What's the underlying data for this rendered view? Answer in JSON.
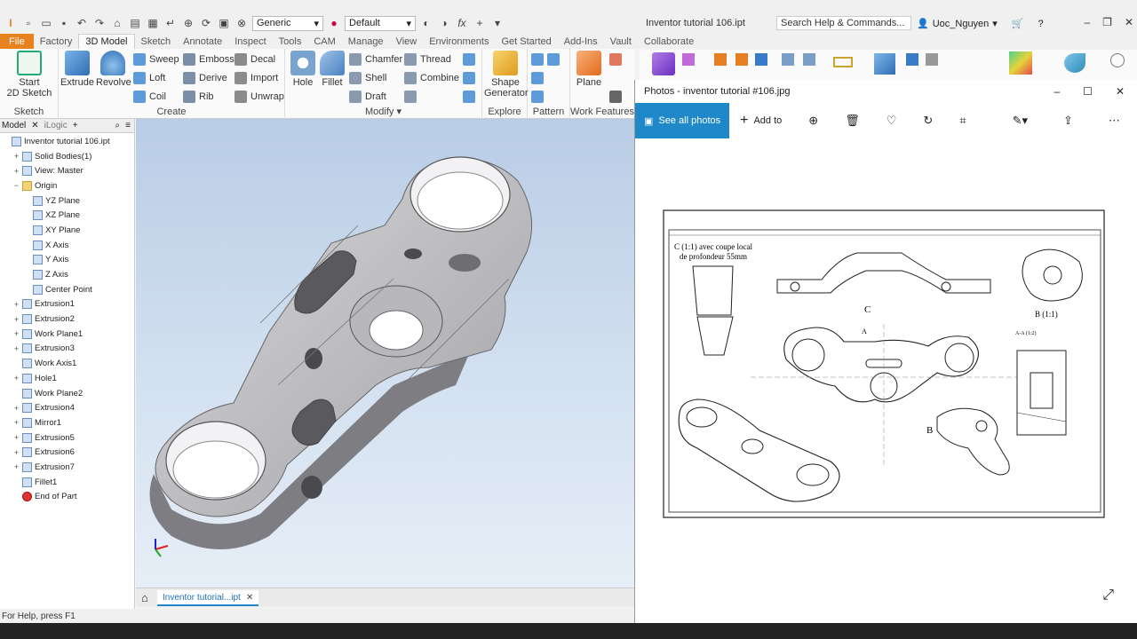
{
  "app": {
    "title": "Inventor tutorial 106.ipt",
    "search_placeholder": "Search Help & Commands...",
    "user": "Uoc_Nguyen",
    "material": "Generic",
    "appearance": "Default"
  },
  "ribbon_tabs": [
    "File",
    "Factory",
    "3D Model",
    "Sketch",
    "Annotate",
    "Inspect",
    "Tools",
    "CAM",
    "Manage",
    "View",
    "Environments",
    "Get Started",
    "Add-Ins",
    "Vault",
    "Collaborate"
  ],
  "ribbon": {
    "sketch": {
      "title": "Sketch",
      "start": "Start",
      "start2": "2D Sketch"
    },
    "create": {
      "title": "Create",
      "extrude": "Extrude",
      "revolve": "Revolve",
      "sweep": "Sweep",
      "emboss": "Emboss",
      "decal": "Decal",
      "loft": "Loft",
      "derive": "Derive",
      "import": "Import",
      "coil": "Coil",
      "rib": "Rib",
      "unwrap": "Unwrap"
    },
    "modify": {
      "title": "Modify",
      "hole": "Hole",
      "fillet": "Fillet",
      "chamfer": "Chamfer",
      "thread": "Thread",
      "shell": "Shell",
      "combine": "Combine",
      "draft": "Draft"
    },
    "explore": {
      "title": "Explore",
      "shape": "Shape",
      "generator": "Generator"
    },
    "pattern": {
      "title": "Pattern"
    },
    "work": {
      "title": "Work Features",
      "plane": "Plane"
    }
  },
  "browser": {
    "tab_model": "Model",
    "tab_ilogic": "iLogic",
    "nodes": [
      {
        "label": "Inventor tutorial 106.ipt",
        "indent": 0,
        "exp": ""
      },
      {
        "label": "Solid Bodies(1)",
        "indent": 1,
        "exp": "+"
      },
      {
        "label": "View: Master",
        "indent": 1,
        "exp": "+"
      },
      {
        "label": "Origin",
        "indent": 1,
        "exp": "−"
      },
      {
        "label": "YZ Plane",
        "indent": 2,
        "exp": ""
      },
      {
        "label": "XZ Plane",
        "indent": 2,
        "exp": ""
      },
      {
        "label": "XY Plane",
        "indent": 2,
        "exp": ""
      },
      {
        "label": "X Axis",
        "indent": 2,
        "exp": ""
      },
      {
        "label": "Y Axis",
        "indent": 2,
        "exp": ""
      },
      {
        "label": "Z Axis",
        "indent": 2,
        "exp": ""
      },
      {
        "label": "Center Point",
        "indent": 2,
        "exp": ""
      },
      {
        "label": "Extrusion1",
        "indent": 1,
        "exp": "+"
      },
      {
        "label": "Extrusion2",
        "indent": 1,
        "exp": "+"
      },
      {
        "label": "Work Plane1",
        "indent": 1,
        "exp": "+"
      },
      {
        "label": "Extrusion3",
        "indent": 1,
        "exp": "+"
      },
      {
        "label": "Work Axis1",
        "indent": 1,
        "exp": ""
      },
      {
        "label": "Hole1",
        "indent": 1,
        "exp": "+"
      },
      {
        "label": "Work Plane2",
        "indent": 1,
        "exp": ""
      },
      {
        "label": "Extrusion4",
        "indent": 1,
        "exp": "+"
      },
      {
        "label": "Mirror1",
        "indent": 1,
        "exp": "+"
      },
      {
        "label": "Extrusion5",
        "indent": 1,
        "exp": "+"
      },
      {
        "label": "Extrusion6",
        "indent": 1,
        "exp": "+"
      },
      {
        "label": "Extrusion7",
        "indent": 1,
        "exp": "+"
      },
      {
        "label": "Fillet1",
        "indent": 1,
        "exp": ""
      },
      {
        "label": "End of Part",
        "indent": 1,
        "exp": ""
      }
    ]
  },
  "document_tab": "Inventor tutorial...ipt",
  "status": "For Help, press F1",
  "photos": {
    "title": "Photos - inventor tutorial #106.jpg",
    "see_all": "See all photos",
    "add_to": "Add to"
  },
  "drawing": {
    "section_note_1": "C (1:1) avec coupe local",
    "section_note_2": "de profondeur 55mm",
    "label_c": "C",
    "label_b": "B",
    "label_b_detail": "B (1:1)",
    "label_a": "A",
    "label_aa": "A-A (1:2)"
  },
  "colors": {
    "accent": "#1e88c9",
    "file_tab": "#e8821e"
  }
}
